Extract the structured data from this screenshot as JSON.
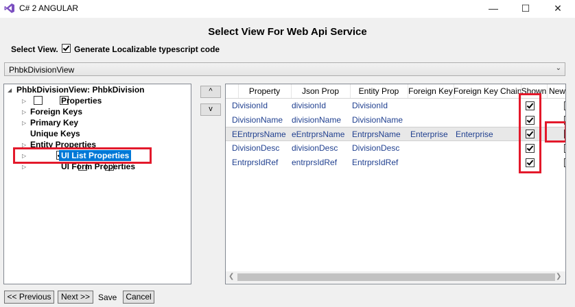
{
  "window": {
    "title": "C# 2 ANGULAR",
    "icon": "visual-studio-icon",
    "controls": {
      "minimize": "—",
      "maximize": "☐",
      "close": "✕"
    }
  },
  "dialog": {
    "title": "Select View For Web Api Service",
    "select_view_label": "Select View.",
    "localize_label": "Generate Localizable typescript code",
    "localize_checked": true
  },
  "view_combo": {
    "selected": "PhbkDivisionView"
  },
  "tree": {
    "root": "PhbkDivisionView: PhbkDivision",
    "items": [
      {
        "label": "Properties",
        "checked": false
      },
      {
        "label": "Foreign Keys"
      },
      {
        "label": "Primary Key"
      },
      {
        "label": "Unique Keys"
      },
      {
        "label": "Entity Properties"
      },
      {
        "label": "UI List Properties",
        "checked": true,
        "selected": true
      },
      {
        "label": "UI Form Properties",
        "checked": false
      }
    ]
  },
  "move_buttons": {
    "up": "^",
    "down": "v"
  },
  "grid": {
    "columns": [
      "Property",
      "Json Prop",
      "Entity Prop",
      "Foreign Key",
      "Foreign Key Chain",
      "Shown",
      "New"
    ],
    "rows": [
      {
        "property": "DivisionId",
        "json": "divisionId",
        "entity": "DivisionId",
        "fk": "",
        "fk_chain": "",
        "shown": true,
        "new": false
      },
      {
        "property": "DivisionName",
        "json": "divisionName",
        "entity": "DivisionName",
        "fk": "",
        "fk_chain": "",
        "shown": true,
        "new": false
      },
      {
        "property": "EEntrprsName",
        "json": "eEntrprsName",
        "entity": "EntrprsName",
        "fk": "Enterprise",
        "fk_chain": "Enterprise",
        "shown": true,
        "new": true
      },
      {
        "property": "DivisionDesc",
        "json": "divisionDesc",
        "entity": "DivisionDesc",
        "fk": "",
        "fk_chain": "",
        "shown": true,
        "new": false
      },
      {
        "property": "EntrprsIdRef",
        "json": "entrprsIdRef",
        "entity": "EntrprsIdRef",
        "fk": "",
        "fk_chain": "",
        "shown": true,
        "new": false
      }
    ]
  },
  "footer": {
    "prev": "<< Previous",
    "next": "Next >>",
    "save": "Save",
    "cancel": "Cancel"
  },
  "colors": {
    "highlight": "#e3192b",
    "selection": "#0078d7",
    "grid_text": "#1f3f8f"
  }
}
